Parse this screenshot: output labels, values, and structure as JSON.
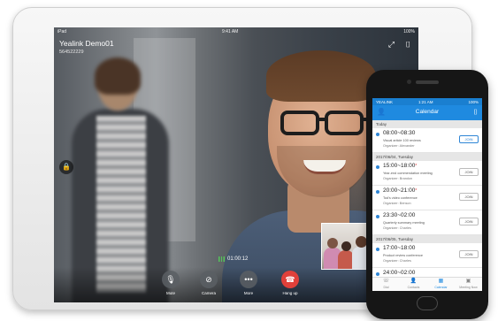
{
  "ipad": {
    "status": {
      "left": "iPad",
      "time": "9:41 AM",
      "battery": "100%"
    },
    "caller_name": "Yealink Demo01",
    "caller_number": "564522229",
    "top_icons": [
      "fullscreen-icon",
      "camera-switch-icon"
    ],
    "lock_icon": "lock-icon",
    "call_duration": "01:00:12",
    "controls": [
      {
        "label": "Mute",
        "icon": "microphone-icon",
        "glyph": "🎙"
      },
      {
        "label": "Camera",
        "icon": "camera-off-icon",
        "glyph": "⊘"
      },
      {
        "label": "More",
        "icon": "more-icon",
        "glyph": "•••"
      },
      {
        "label": "Hang up",
        "icon": "hangup-icon",
        "glyph": "☎"
      }
    ]
  },
  "phone": {
    "status": {
      "carrier": "YEALINK",
      "time": "1:21 AM",
      "battery": "100%"
    },
    "title": "Calendar",
    "sections": [
      {
        "day": "Today",
        "events": [
          {
            "time": "08:00~08:30",
            "star": "",
            "topic": "Visual article 100 reviews",
            "organizer": "Organizer: Alexander",
            "action": "JOIN"
          }
        ]
      },
      {
        "day": "2017/06/04,  Tuesday",
        "events": [
          {
            "time": "15:00~18:00",
            "star": "*",
            "topic": "Year-end commendation meeting",
            "organizer": "Organizer: Brandon",
            "action": "JOIN"
          },
          {
            "time": "20:00~21:00",
            "star": "*",
            "topic": "Tod's video conference",
            "organizer": "Organizer: Benson",
            "action": "JOIN"
          },
          {
            "time": "23:30~02:00",
            "star": "",
            "topic": "Quarterly summary meeting",
            "organizer": "Organizer: Charles",
            "action": "JOIN"
          }
        ]
      },
      {
        "day": "2017/06/05,  Tuesday",
        "events": [
          {
            "time": "17:00~18:00",
            "star": "",
            "topic": "Product review conference",
            "organizer": "Organizer: Charles",
            "action": "JOIN"
          },
          {
            "time": "24:00~02:00",
            "star": "",
            "topic": "",
            "organizer": "",
            "action": ""
          }
        ]
      }
    ],
    "tabs": [
      {
        "label": "Dial",
        "icon": "dial-icon",
        "glyph": "☏"
      },
      {
        "label": "Contacts",
        "icon": "contacts-icon",
        "glyph": "👤"
      },
      {
        "label": "Calendar",
        "icon": "calendar-icon",
        "glyph": "▦"
      },
      {
        "label": "Meeting Now",
        "icon": "meeting-now-icon",
        "glyph": "▣"
      }
    ],
    "accent_color": "#1f8ae0"
  }
}
